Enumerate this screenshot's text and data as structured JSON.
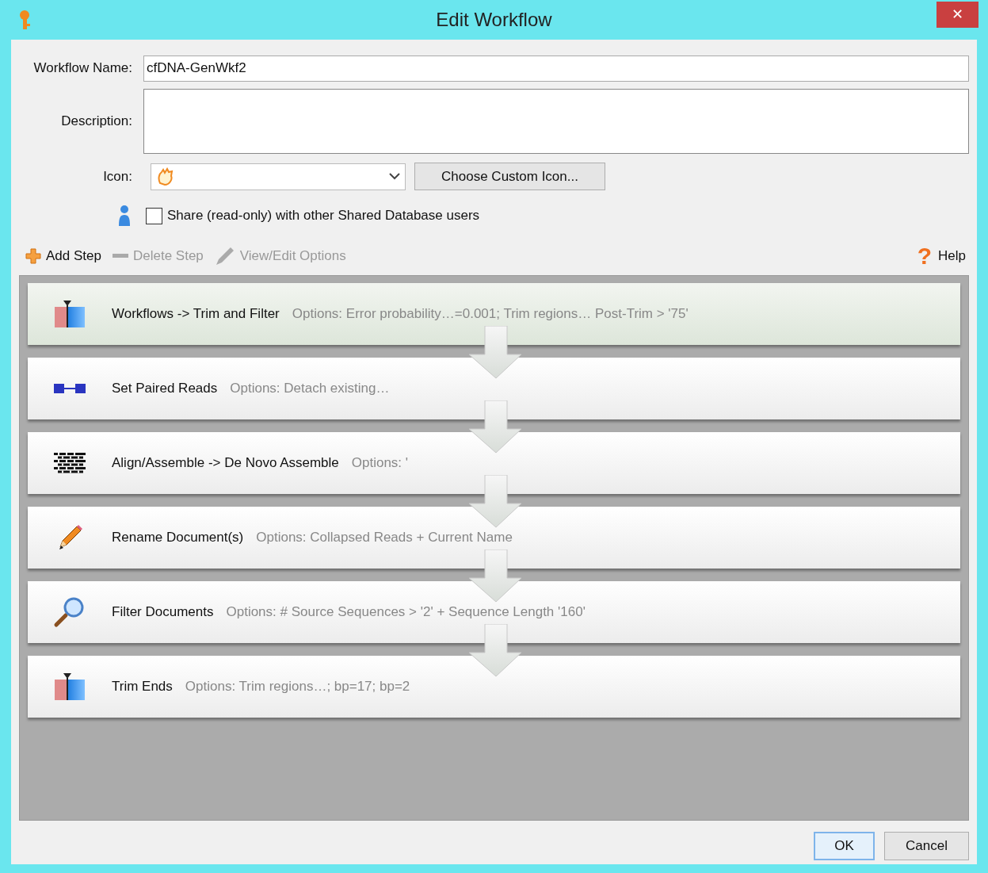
{
  "window": {
    "title": "Edit Workflow",
    "close": "✕"
  },
  "form": {
    "name_label": "Workflow Name:",
    "name_value": "cfDNA-GenWkf2",
    "description_label": "Description:",
    "icon_label": "Icon:",
    "choose_icon_button": "Choose Custom Icon...",
    "share": {
      "label": "Share (read-only) with other Shared Database users",
      "checked": false
    }
  },
  "toolbar": [
    {
      "kind": "add",
      "label": "Add Step",
      "disabled": false
    },
    {
      "kind": "delete",
      "label": "Delete Step",
      "disabled": true
    },
    {
      "kind": "edit",
      "label": "View/Edit Options",
      "disabled": true
    }
  ],
  "help": {
    "symbol": "?",
    "label": "Help"
  },
  "steps": [
    {
      "kind": "trim",
      "name": "Workflows -> Trim and Filter",
      "options": "Options: Error probability…=0.001; Trim regions… Post-Trim > '75'",
      "selected": true
    },
    {
      "kind": "paired",
      "name": "Set Paired Reads",
      "options": "Options: Detach existing…",
      "selected": false
    },
    {
      "kind": "assemble",
      "name": "Align/Assemble -> De Novo Assemble",
      "options": "Options: '",
      "selected": false
    },
    {
      "kind": "rename",
      "name": "Rename Document(s)",
      "options": "Options: Collapsed Reads + Current Name",
      "selected": false
    },
    {
      "kind": "filter",
      "name": "Filter Documents",
      "options": "Options: # Source Sequences > '2' + Sequence Length '160'",
      "selected": false
    },
    {
      "kind": "trim",
      "name": "Trim Ends",
      "options": "Options: Trim regions…; bp=17; bp=2",
      "selected": false
    }
  ],
  "buttons": [
    {
      "label": "OK",
      "default": true
    },
    {
      "label": "Cancel",
      "default": false
    }
  ]
}
